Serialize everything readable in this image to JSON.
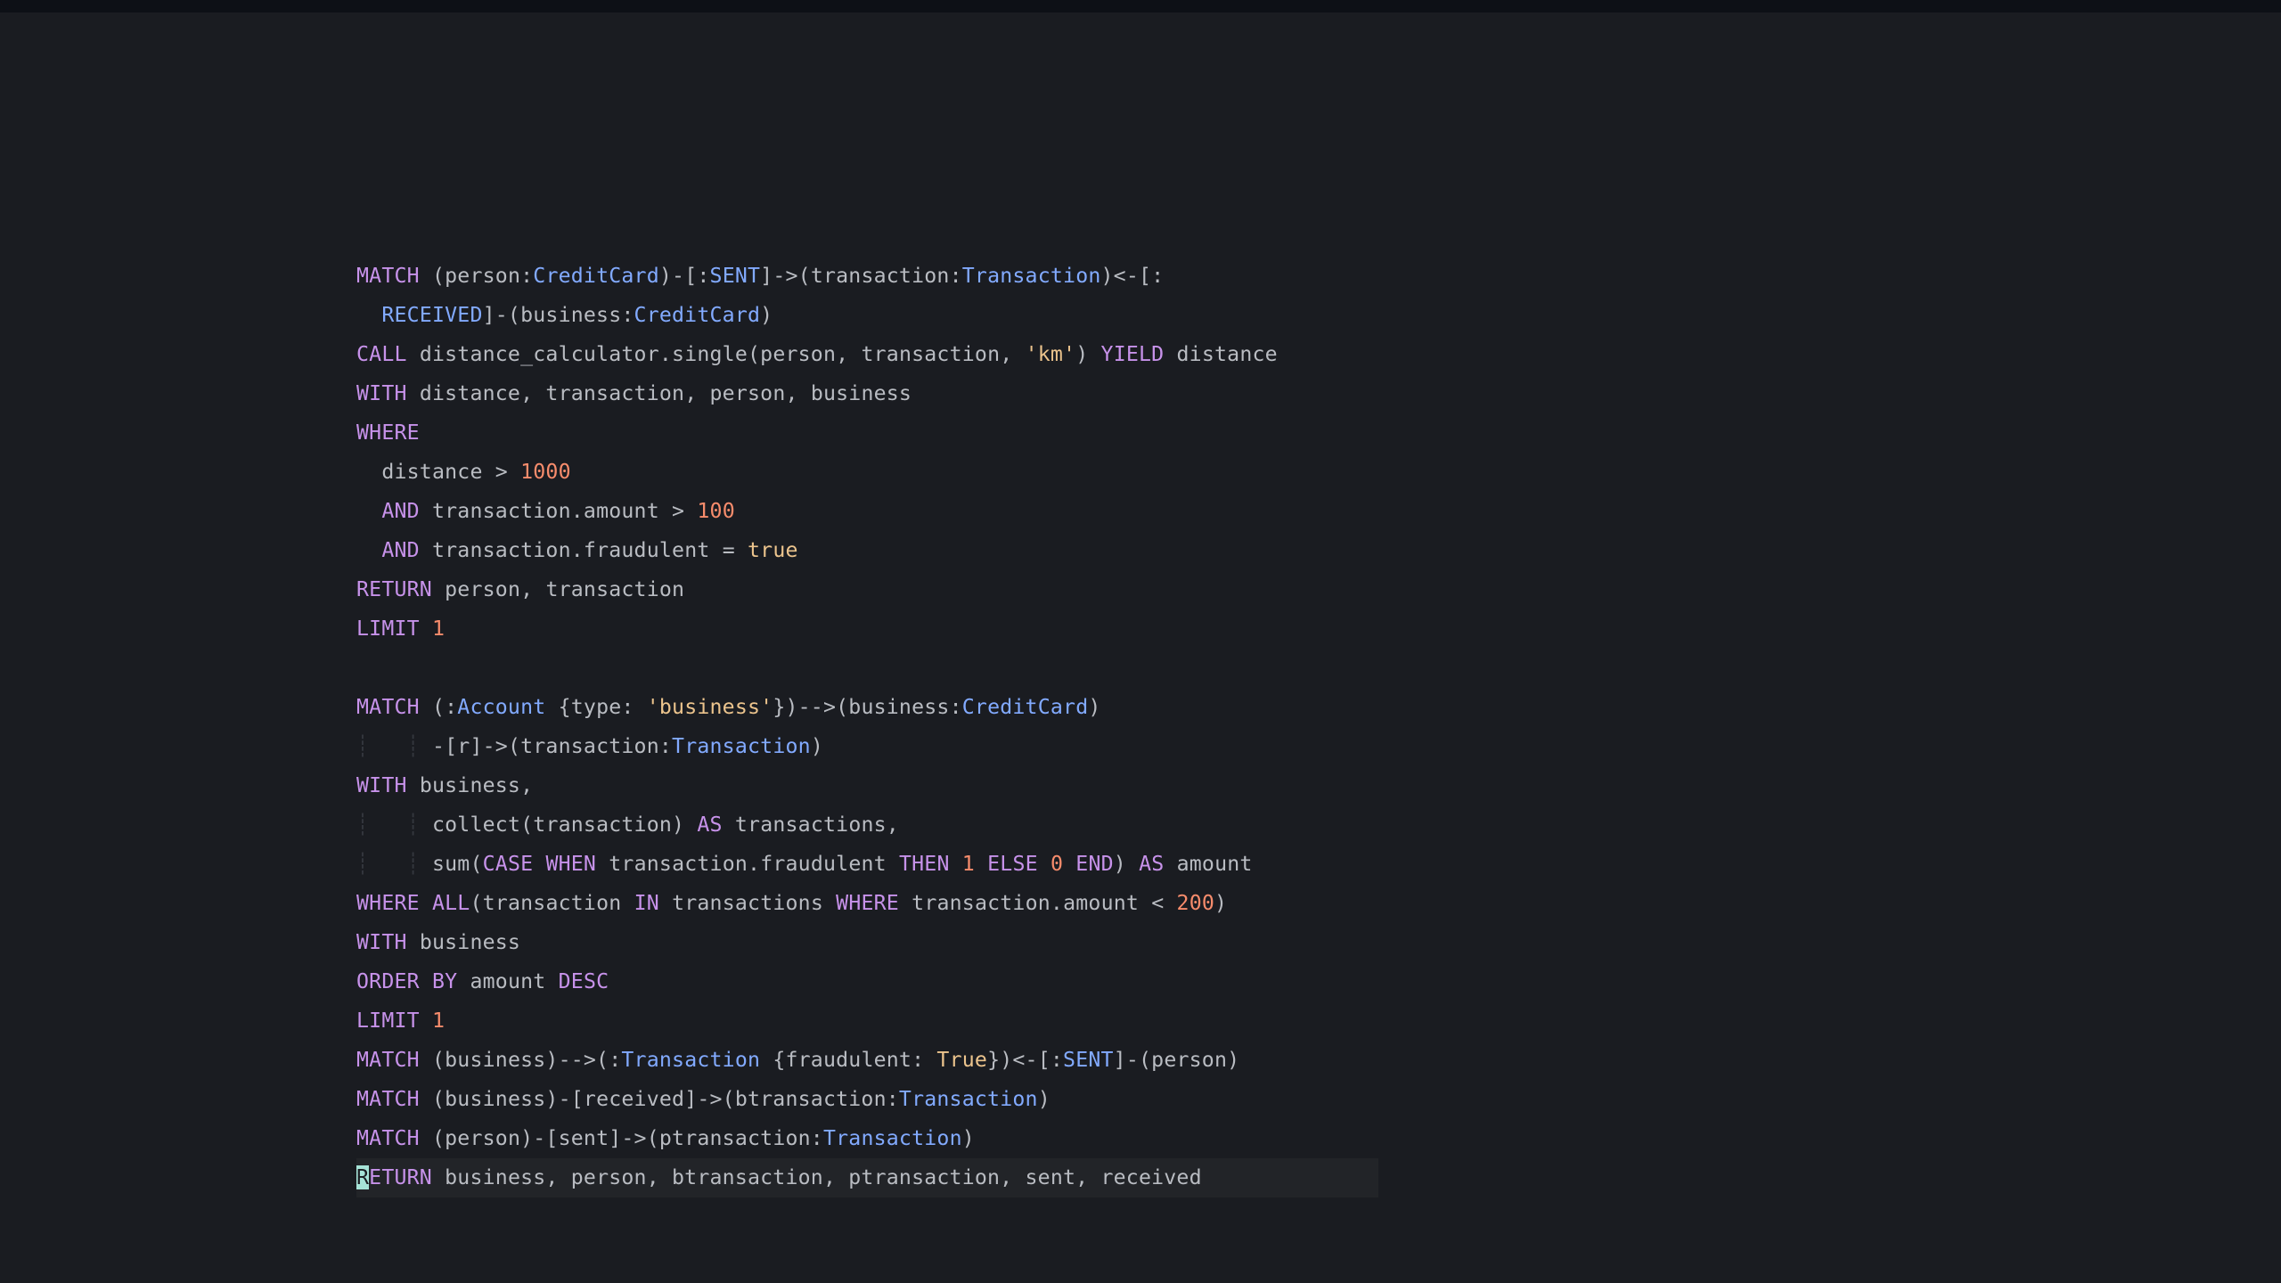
{
  "colors": {
    "background": "#1a1c21",
    "topbar": "#0d1016",
    "text": "#b9bcc2",
    "keyword": "#c792ea",
    "type": "#82aaff",
    "string": "#ecc48d",
    "number": "#f78c6c",
    "indent_guide": "#35383f",
    "cursor_bg": "#a6e3d7",
    "current_line_bg": "#222428"
  },
  "tokens": {
    "MATCH": "MATCH",
    "CALL": "CALL",
    "WITH": "WITH",
    "WHERE": "WHERE",
    "AND": "AND",
    "RETURN": "RETURN",
    "LIMIT": "LIMIT",
    "YIELD": "YIELD",
    "AS": "AS",
    "CASE": "CASE",
    "WHEN": "WHEN",
    "THEN": "THEN",
    "ELSE": "ELSE",
    "END": "END",
    "ALL": "ALL",
    "IN": "IN",
    "ORDER": "ORDER",
    "BY": "BY",
    "DESC": "DESC",
    "person": "person",
    "business": "business",
    "transaction": "transaction",
    "transactions": "transactions",
    "distance": "distance",
    "amount": "amount",
    "sent": "sent",
    "received": "received",
    "btransaction": "btransaction",
    "ptransaction": "ptransaction",
    "r": "r",
    "CreditCard": "CreditCard",
    "Transaction": "Transaction",
    "Account": "Account",
    "SENT": "SENT",
    "RECEIVED": "RECEIVED",
    "distance_calculator": "distance_calculator",
    "single": "single",
    "collect": "collect",
    "sum": "sum",
    "type": "type",
    "fraudulent": "fraudulent",
    "amount_prop": "amount",
    "km": "'km'",
    "business_str": "'business'",
    "n1000": "1000",
    "n100": "100",
    "n200": "200",
    "n1": "1",
    "n0": "0",
    "true": "true",
    "True": "True",
    "ETURN": "ETURN",
    "R": "R",
    "ret_list": " business, person, btransaction, ptransaction, sent, received"
  }
}
